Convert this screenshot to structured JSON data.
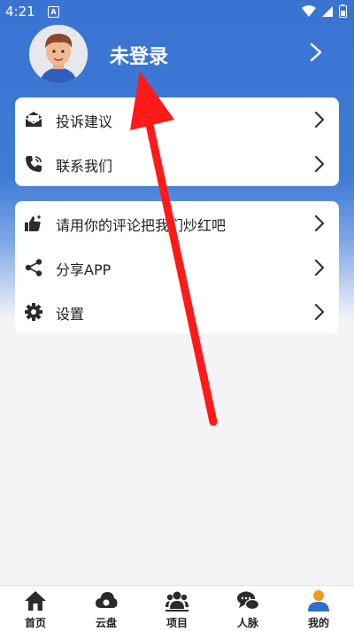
{
  "status_bar": {
    "time": "4:21",
    "notification": "A"
  },
  "profile": {
    "username": "未登录"
  },
  "card1": {
    "items": [
      {
        "label": "投诉建议",
        "icon": "mail-icon"
      },
      {
        "label": "联系我们",
        "icon": "phone-icon"
      }
    ]
  },
  "card2": {
    "items": [
      {
        "label": "请用你的评论把我们炒红吧",
        "icon": "thumbs-up-icon"
      },
      {
        "label": "分享APP",
        "icon": "share-icon"
      },
      {
        "label": "设置",
        "icon": "gear-icon"
      }
    ]
  },
  "tabbar": {
    "tabs": [
      {
        "label": "首页",
        "icon": "home-icon"
      },
      {
        "label": "云盘",
        "icon": "cloud-icon"
      },
      {
        "label": "项目",
        "icon": "group-icon"
      },
      {
        "label": "人脉",
        "icon": "chat-icon"
      },
      {
        "label": "我的",
        "icon": "person-icon",
        "active": true
      }
    ]
  },
  "colors": {
    "header_blue": "#3a73d2",
    "annotation_red": "#ff1a1a",
    "active_tab_orange": "#f39a1e",
    "active_tab_blue": "#2f6fd0"
  }
}
